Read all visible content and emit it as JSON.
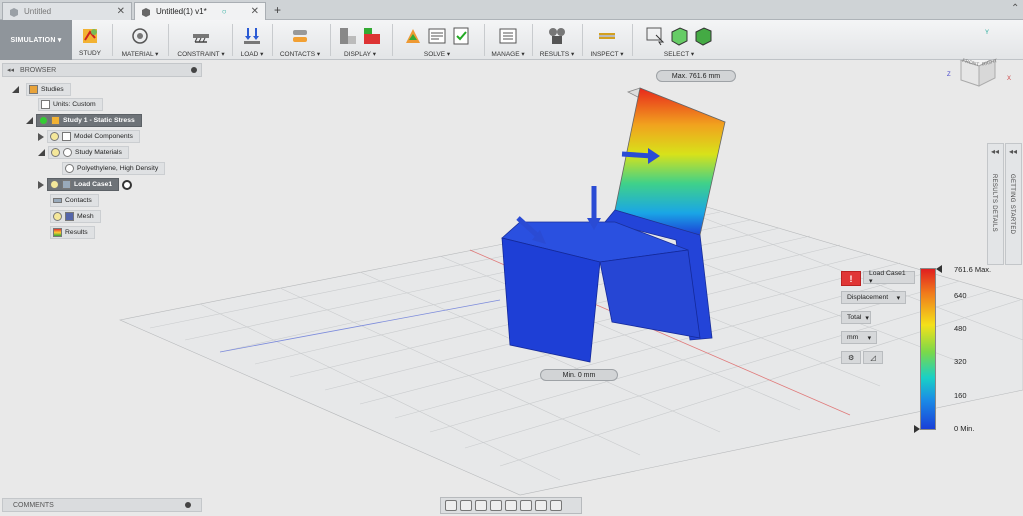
{
  "tabs": [
    {
      "label": "Untitled",
      "active": false
    },
    {
      "label": "Untitled(1) v1*",
      "active": true
    }
  ],
  "ribbon": {
    "environment": "SIMULATION ▾",
    "groups": [
      {
        "label": "STUDY",
        "icon": "study-icon"
      },
      {
        "label": "MATERIAL ▾",
        "icon": "material-icon"
      },
      {
        "label": "CONSTRAINT ▾",
        "icon": "constraint-icon"
      },
      {
        "label": "LOAD ▾",
        "icon": "load-icon"
      },
      {
        "label": "CONTACTS ▾",
        "icon": "contacts-icon"
      },
      {
        "label": "DISPLAY ▾",
        "icon": "display-icon"
      },
      {
        "label": "SOLVE ▾",
        "icon": "solve-icon"
      },
      {
        "label": "MANAGE ▾",
        "icon": "manage-icon"
      },
      {
        "label": "RESULTS ▾",
        "icon": "results-icon"
      },
      {
        "label": "INSPECT ▾",
        "icon": "inspect-icon"
      },
      {
        "label": "SELECT ▾",
        "icon": "select-icon"
      }
    ]
  },
  "browser": {
    "title": "BROWSER",
    "items": [
      {
        "label": "Studies"
      },
      {
        "label": "Units: Custom"
      },
      {
        "label": "Study 1 - Static Stress"
      },
      {
        "label": "Model Components"
      },
      {
        "label": "Study Materials"
      },
      {
        "label": "Polyethylene, High Density"
      },
      {
        "label": "Load Case1"
      },
      {
        "label": "Contacts"
      },
      {
        "label": "Mesh"
      },
      {
        "label": "Results"
      }
    ]
  },
  "comments": {
    "title": "COMMENTS"
  },
  "viewport": {
    "max_callout": "Max. 761.6 mm",
    "min_callout": "Min. 0 mm"
  },
  "viewcube": {
    "front": "FRONT",
    "right": "RIGHT",
    "axis_x": "X",
    "axis_y": "Y",
    "axis_z": "Z"
  },
  "sidepanels": {
    "results_details": "RESULTS DETAILS",
    "getting_started": "GETTING STARTED"
  },
  "legend": {
    "load_case": "Load Case1 ▾",
    "result_type": "Displacement",
    "component": "Total",
    "units": "mm",
    "labels": [
      "761.6 Max.",
      "640",
      "480",
      "320",
      "160",
      "0 Min."
    ],
    "colors": [
      "#e02020",
      "#f0a020",
      "#f2e61a",
      "#3fd070",
      "#19b8e0",
      "#1a3fd8"
    ]
  }
}
